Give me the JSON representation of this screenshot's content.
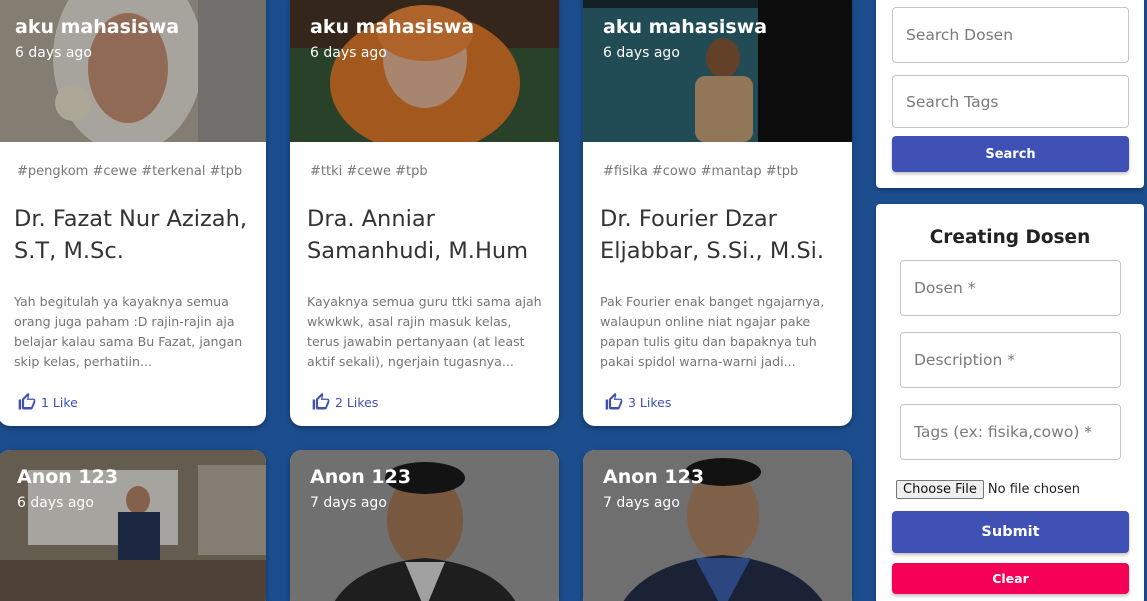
{
  "cards": [
    {
      "author": "aku mahasiswa",
      "date": "6 days ago",
      "tags": "#pengkom #cewe #terkenal #tpb",
      "title": "Dr. Fazat Nur Azizah, S.T, M.Sc.",
      "description": "Yah begitulah ya kayaknya semua orang juga paham :D rajin-rajin aja belajar kalau sama Bu Fazat, jangan skip kelas, perhatiin...",
      "likes": "1 Like",
      "media_color": "#b6a893"
    },
    {
      "author": "aku mahasiswa",
      "date": "6 days ago",
      "tags": "#ttki #cewe #tpb",
      "title": "Dra. Anniar Samanhudi, M.Hum",
      "description": "Kayaknya semua guru ttki sama ajah wkwkwk, asal rajin masuk kelas, terus jawabin pertanyaan (at least aktif sekali), ngerjain tugasnya...",
      "likes": "2 Likes",
      "media_color": "#6e4a3a"
    },
    {
      "author": "aku mahasiswa",
      "date": "6 days ago",
      "tags": "#fisika #cowo #mantap #tpb",
      "title": "Dr. Fourier Dzar Eljabbar, S.Si., M.Si.",
      "description": "Pak Fourier enak banget ngajarnya, walaupun online niat ngajar pake papan tulis gitu dan bapaknya tuh pakai spidol warna-warni jadi...",
      "likes": "3 Likes",
      "media_color": "#3a4a55"
    }
  ],
  "bottom_cards": [
    {
      "author": "Anon 123",
      "date": "6 days ago",
      "media_color": "#8a7a6a"
    },
    {
      "author": "Anon 123",
      "date": "7 days ago",
      "media_color": "#7b7b7b"
    },
    {
      "author": "Anon 123",
      "date": "7 days ago",
      "media_color": "#7a7a7a"
    }
  ],
  "search": {
    "dosen_placeholder": "Search Dosen",
    "tags_placeholder": "Search Tags",
    "button_label": "Search"
  },
  "create": {
    "title": "Creating Dosen",
    "dosen_label": "Dosen *",
    "description_label": "Description *",
    "tags_label": "Tags (ex: fisika,cowo) *",
    "file_button": "Choose File",
    "file_status": "No file chosen",
    "submit_label": "Submit",
    "clear_label": "Clear"
  },
  "colors": {
    "background": "#1c4e8f",
    "primary": "#3f51b5",
    "danger": "#f50057"
  }
}
